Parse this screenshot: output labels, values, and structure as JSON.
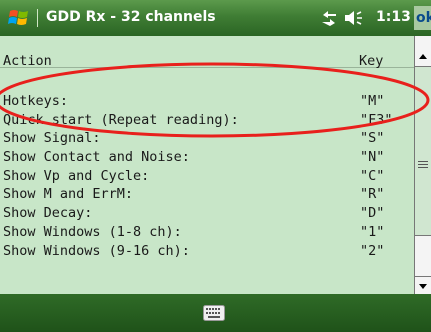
{
  "titlebar": {
    "title": "GDD Rx - 32 channels",
    "clock": "1:13",
    "ok_label": "ok"
  },
  "list": {
    "headers": {
      "action": "Action",
      "key": "Key"
    },
    "rows": [
      {
        "action": "Hotkeys:",
        "key": "\"M\""
      },
      {
        "action": "Quick start (Repeat reading):",
        "key": "\"F3\""
      },
      {
        "action": "Show Signal:",
        "key": "\"S\""
      },
      {
        "action": "Show Contact and Noise:",
        "key": "\"N\""
      },
      {
        "action": "Show Vp and Cycle:",
        "key": "\"C\""
      },
      {
        "action": "Show M and ErrM:",
        "key": "\"R\""
      },
      {
        "action": "Show Decay:",
        "key": "\"D\""
      },
      {
        "action": "Show Windows (1-8 ch):",
        "key": "\"1\""
      },
      {
        "action": "Show Windows (9-16 ch):",
        "key": "\"2\""
      }
    ]
  },
  "colors": {
    "list_bg": "#c8e6c8",
    "titlebar": "#3f7d34",
    "annotation": "#e8201c"
  },
  "icons": {
    "start": "windows-start-icon",
    "connectivity": "connectivity-icon",
    "volume": "speaker-icon",
    "keyboard": "keyboard-icon"
  }
}
